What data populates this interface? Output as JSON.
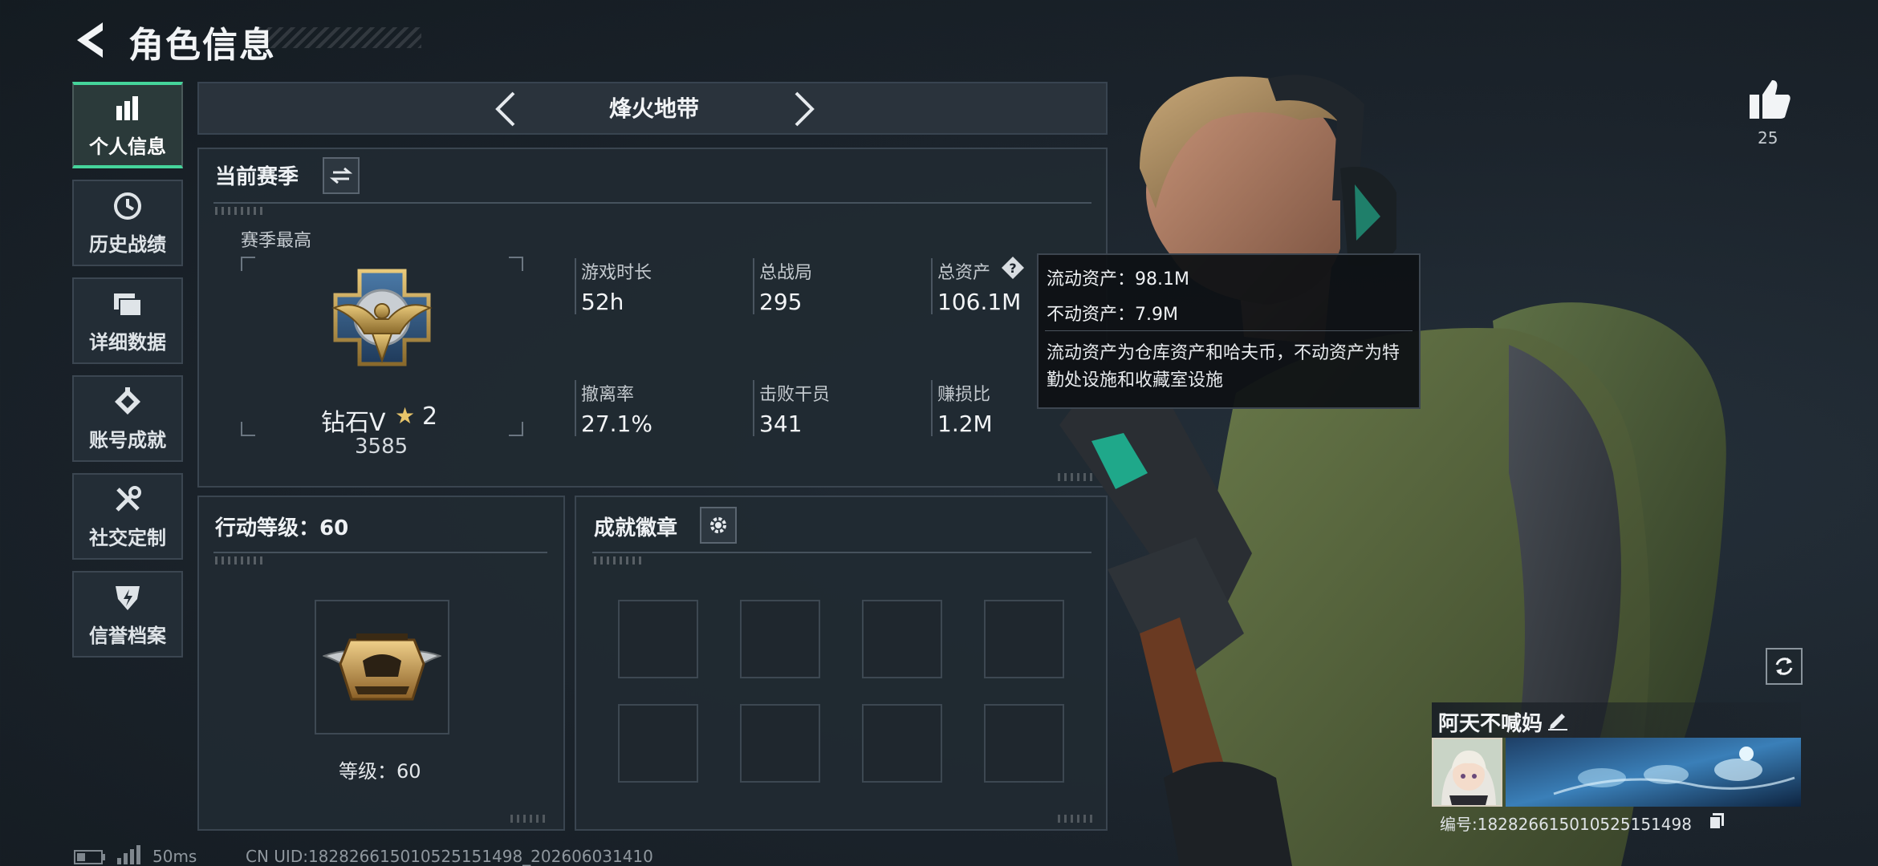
{
  "header": {
    "title": "角色信息"
  },
  "nav": {
    "items": [
      {
        "label": "个人信息",
        "icon": "bar-chart-icon",
        "active": true
      },
      {
        "label": "历史战绩",
        "icon": "clock-icon",
        "active": false
      },
      {
        "label": "详细数据",
        "icon": "folders-icon",
        "active": false
      },
      {
        "label": "账号成就",
        "icon": "achievement-icon",
        "active": false
      },
      {
        "label": "社交定制",
        "icon": "tools-icon",
        "active": false
      },
      {
        "label": "信誉档案",
        "icon": "reputation-icon",
        "active": false
      }
    ]
  },
  "mode": {
    "label": "烽火地带"
  },
  "season": {
    "title": "当前赛季",
    "best_label": "赛季最高",
    "rank_name": "钻石V",
    "rank_star_icon": "star-icon",
    "rank_stars": "2",
    "rank_score": "3585",
    "stats": [
      {
        "label": "游戏时长",
        "value": "52h"
      },
      {
        "label": "总战局",
        "value": "295"
      },
      {
        "label": "总资产",
        "value": "106.1M"
      },
      {
        "label": "撤离率",
        "value": "27.1%"
      },
      {
        "label": "击败干员",
        "value": "341"
      },
      {
        "label": "赚损比",
        "value": "1.2M"
      }
    ]
  },
  "tooltip": {
    "liquid_line": "流动资产：98.1M",
    "fixed_line": "不动资产：7.9M",
    "description": "流动资产为仓库资产和哈夫币，不动资产为特勤处设施和收藏室设施"
  },
  "level": {
    "title": "行动等级：60",
    "text": "等级：60"
  },
  "achievements": {
    "title": "成就徽章",
    "slot_count": 8
  },
  "player": {
    "like_count": "25",
    "name": "阿天不喊妈",
    "id_text": "编号:18282661501052515149​8"
  },
  "footer": {
    "ping": "50ms",
    "uid": "CN UID:18282661501052515149​8_202606031410"
  },
  "colors": {
    "accent": "#45d49b",
    "panel_bg": "#212a32",
    "border": "#3a4550"
  }
}
